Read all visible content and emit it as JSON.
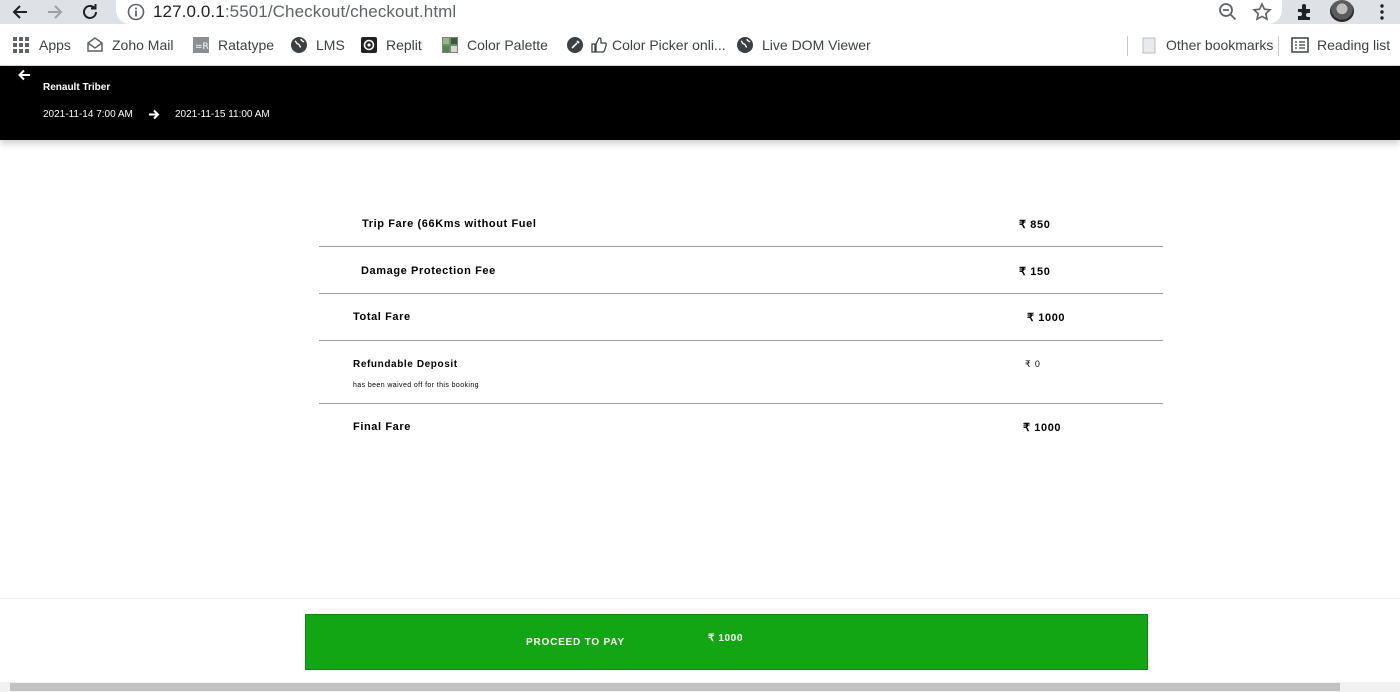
{
  "browser": {
    "url_host": "127.0.0.1",
    "url_rest": ":5501/Checkout/checkout.html",
    "bookmarks": [
      {
        "label": "Apps",
        "icon": "apps-grid-icon"
      },
      {
        "label": "Zoho Mail",
        "icon": "mail-icon"
      },
      {
        "label": "Ratatype",
        "icon": "ratatype-icon"
      },
      {
        "label": "LMS",
        "icon": "globe-icon"
      },
      {
        "label": "Replit",
        "icon": "replit-icon"
      },
      {
        "label": "Color Palette",
        "icon": "palette-icon"
      },
      {
        "label": "Color Picker onli...",
        "icon": "color-picker-icon"
      },
      {
        "label": "Live DOM Viewer",
        "icon": "globe-icon"
      },
      {
        "label": "Other bookmarks",
        "icon": "folder-icon"
      },
      {
        "label": "Reading list",
        "icon": "reading-list-icon"
      }
    ]
  },
  "header": {
    "car_name": "Renault Triber",
    "start": "2021-11-14 7:00 AM",
    "end": "2021-11-15 11:00 AM"
  },
  "fare": {
    "trip_label": "Trip Fare (66Kms without Fuel",
    "trip_amount": "₹ 850",
    "damage_label": "Damage Protection Fee",
    "damage_amount": "₹ 150",
    "total_label": "Total Fare",
    "total_amount": "₹ 1000",
    "deposit_label": "Refundable Deposit",
    "deposit_amount": "₹ 0",
    "deposit_note": "has been waived off for this booking",
    "final_label": "Final Fare",
    "final_amount": "₹ 1000"
  },
  "footer": {
    "pay_label": "PROCEED TO PAY",
    "pay_amount": "₹ 1000"
  },
  "colors": {
    "header_bg": "#000000",
    "pay_button": "#13a614"
  }
}
